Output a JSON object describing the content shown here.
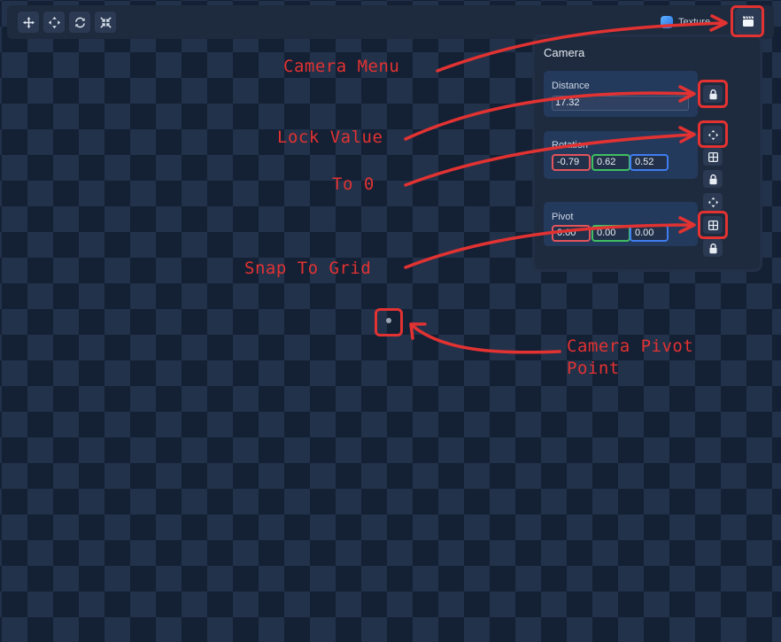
{
  "toolbar": {
    "tools": [
      {
        "icon": "move-icon"
      },
      {
        "icon": "pan-icon"
      },
      {
        "icon": "rotate-icon"
      },
      {
        "icon": "scale-icon"
      }
    ],
    "texture_label": "Texture",
    "camera_menu_icon": "clapperboard-icon"
  },
  "camera_panel": {
    "title": "Camera",
    "distance": {
      "label": "Distance",
      "value": "17.32"
    },
    "rotation": {
      "label": "Rotation",
      "x": "-0.79",
      "y": "0.62",
      "z": "0.52"
    },
    "pivot": {
      "label": "Pivot",
      "x": "0.00",
      "y": "0.00",
      "z": "0.00"
    }
  },
  "annotations": {
    "camera_menu": "Camera Menu",
    "lock_value": "Lock Value",
    "to_zero": "To 0",
    "snap_to_grid": "Snap To Grid",
    "pivot_point_line1": "Camera Pivot",
    "pivot_point_line2": "Point",
    "color": "#e23232"
  },
  "colors": {
    "x_axis": "#e2545c",
    "y_axis": "#3fbf62",
    "z_axis": "#3f7df0"
  }
}
